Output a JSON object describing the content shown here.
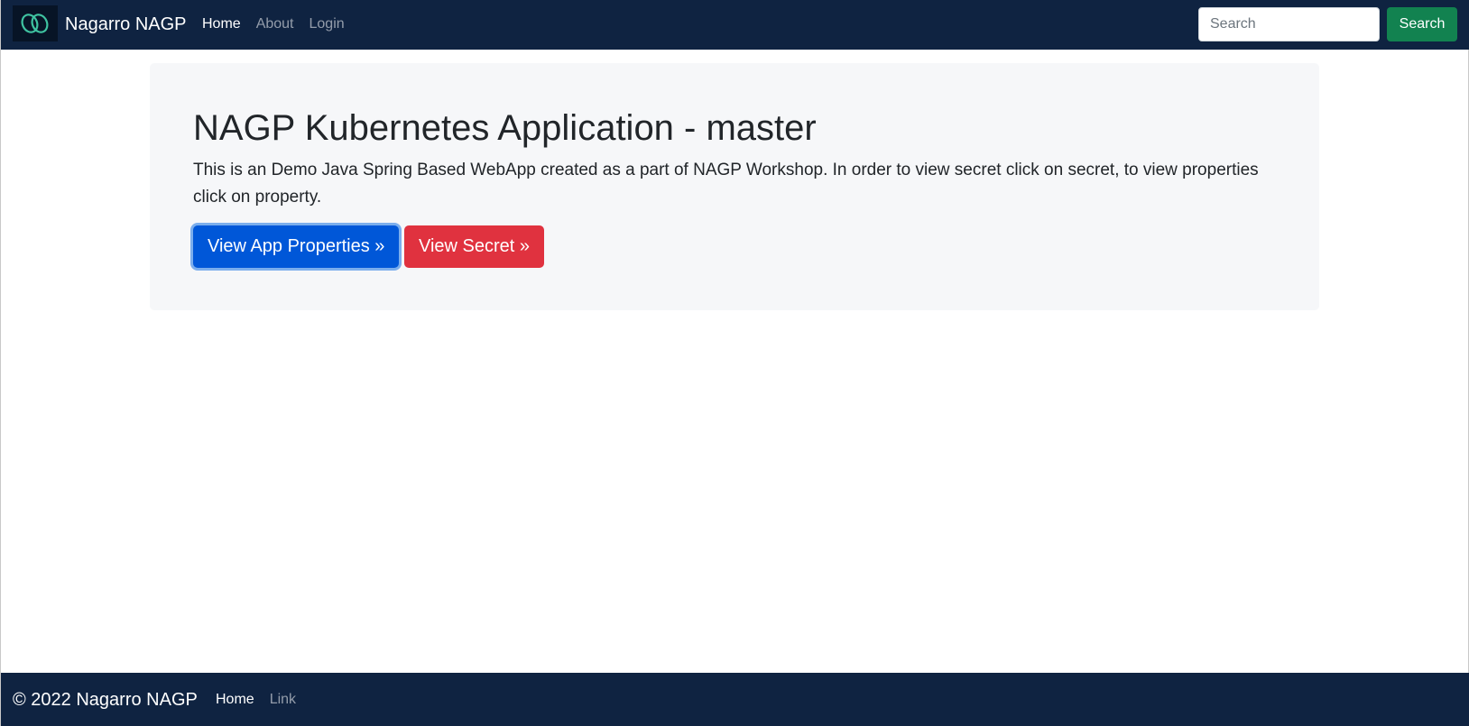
{
  "navbar": {
    "brand": "Nagarro NAGP",
    "logo_icon": "nagarro-logo-icon",
    "links": [
      {
        "label": "Home",
        "active": true
      },
      {
        "label": "About",
        "active": false
      },
      {
        "label": "Login",
        "active": false
      }
    ],
    "search": {
      "placeholder": "Search",
      "value": "",
      "button_label": "Search"
    }
  },
  "jumbotron": {
    "title": "NAGP Kubernetes Application - master",
    "description": "This is an Demo Java Spring Based WebApp created as a part of NAGP Workshop. In order to view secret click on secret, to view properties click on property.",
    "buttons": {
      "properties_label": "View App Properties »",
      "secret_label": "View Secret »"
    }
  },
  "footer": {
    "copyright": "© 2022 Nagarro NAGP",
    "links": [
      {
        "label": "Home",
        "active": true
      },
      {
        "label": "Link",
        "active": false
      }
    ]
  },
  "colors": {
    "navbar_bg": "#0f2341",
    "primary": "#0057d8",
    "danger": "#e0323f",
    "success": "#128250",
    "jumbotron_bg": "#f6f7f9"
  }
}
